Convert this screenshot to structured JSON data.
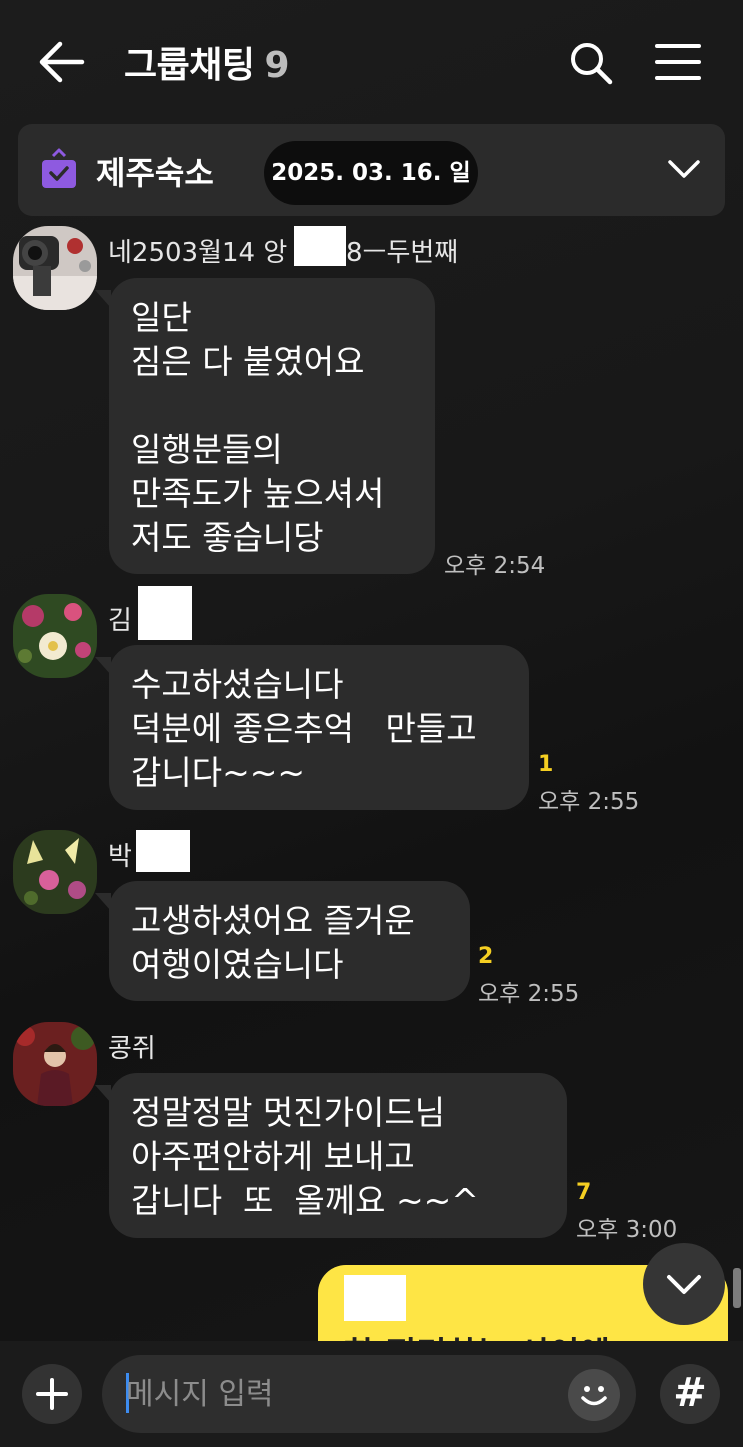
{
  "header": {
    "title": "그룹채팅",
    "member_count": "9"
  },
  "notice": {
    "text": "제주숙소"
  },
  "date_divider": "2025. 03. 16. 일",
  "messages": [
    {
      "sender": "네2503월14 앙",
      "sender_suffix": "8ㅡ두번째",
      "text": "일단\n짐은 다 붙였어요\n\n일행분들의\n만족도가 높으셔서\n저도 좋습니당",
      "unread": "",
      "time": "오후 2:54"
    },
    {
      "sender": "김",
      "sender_suffix": "",
      "text": "수고하셨습니다\n덕분에 좋은추억   만들고\n갑니다~~~",
      "unread": "1",
      "time": "오후 2:55"
    },
    {
      "sender": "박",
      "sender_suffix": "",
      "text": "고생하셨어요 즐거운\n여행이였습니다",
      "unread": "2",
      "time": "오후 2:55"
    },
    {
      "sender": "콩쥐",
      "sender_suffix": "",
      "text": "정말정말 멋진가이드님\n아주편안하게 보내고\n갑니다  또  올께요 ~~^",
      "unread": "7",
      "time": "오후 3:00"
    }
  ],
  "my_message_partial": "한 정리하는 시이에",
  "input": {
    "placeholder": "메시지 입력"
  },
  "hash_label": "#",
  "colors": {
    "background": "#141414",
    "bubble": "#2c2c2c",
    "my_bubble": "#fee545",
    "unread": "#f5cf22",
    "notice_icon": "#8e5ae0"
  }
}
